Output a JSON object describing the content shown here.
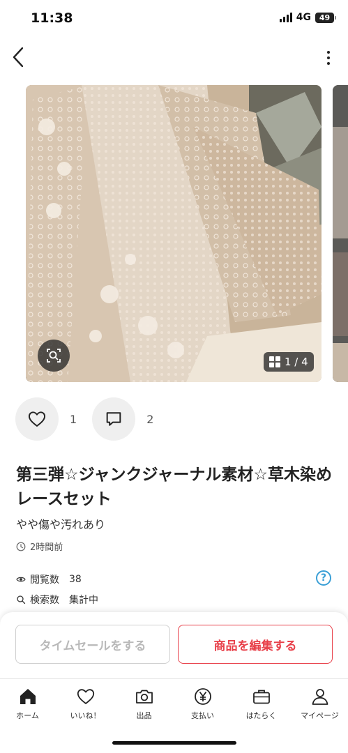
{
  "status_bar": {
    "time": "11:38",
    "network": "4G",
    "battery": "49"
  },
  "header": {
    "back_icon": "chevron-left-icon",
    "more_icon": "more-vertical-icon"
  },
  "gallery": {
    "counter": "1 / 4",
    "zoom_icon": "image-search-icon",
    "grid_icon": "grid-icon"
  },
  "reactions": {
    "like_count": "1",
    "comment_count": "2"
  },
  "item": {
    "title": "第三弾☆ジャンクジャーナル素材☆草木染めレースセット",
    "condition": "やや傷や汚れあり",
    "posted": "2時間前"
  },
  "stats": {
    "views_label": "閲覧数",
    "views_value": "38",
    "search_label": "検索数",
    "search_value": "集計中",
    "help_label": "?"
  },
  "actions": {
    "timesale_label": "タイムセールをする",
    "edit_label": "商品を編集する"
  },
  "colors": {
    "accent": "#e8404a",
    "help": "#3a9fd6",
    "disabled": "#b9b9b9"
  },
  "tab_bar": {
    "items": [
      {
        "label": "ホーム",
        "icon": "home-icon"
      },
      {
        "label": "いいね！",
        "icon": "heart-icon"
      },
      {
        "label": "出品",
        "icon": "camera-icon"
      },
      {
        "label": "支払い",
        "icon": "yen-icon"
      },
      {
        "label": "はたらく",
        "icon": "briefcase-icon"
      },
      {
        "label": "マイページ",
        "icon": "person-icon"
      }
    ]
  }
}
